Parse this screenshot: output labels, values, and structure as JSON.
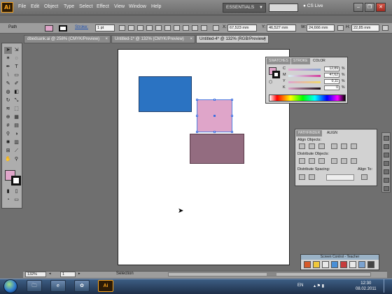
{
  "app": {
    "badge": "Ai"
  },
  "menu": [
    "File",
    "Edit",
    "Object",
    "Type",
    "Select",
    "Effect",
    "View",
    "Window",
    "Help"
  ],
  "workspace": {
    "label": "ESSENTIALS"
  },
  "cslive": {
    "label": "CS Live"
  },
  "window_controls": {
    "minimize": "–",
    "restore": "❐",
    "close": "✕"
  },
  "control_bar": {
    "selection_type": "Path",
    "stroke_label": "Stroke:",
    "stroke_weight": "1 pt",
    "x_label": "X:",
    "x_value": "67,523 mm",
    "y_label": "Y:",
    "y_value": "46,527 mm",
    "w_label": "W:",
    "w_value": "24,666 mm",
    "h_label": "H:",
    "h_value": "22,85 mm"
  },
  "doc_tabs": [
    {
      "label": "dbedsank.ai @ 258% (CMYK/Preview)"
    },
    {
      "label": "Untitled-1* @ 132% (CMYK/Preview)"
    },
    {
      "label": "Untitled-4* @ 132% (RGB/Preview)"
    }
  ],
  "color_panel": {
    "tabs": [
      "SWATCHES",
      "STROKE",
      "COLOR"
    ],
    "channels": [
      {
        "label": "C",
        "value": "12,89"
      },
      {
        "label": "M",
        "value": "47,62"
      },
      {
        "label": "Y",
        "value": "0,11"
      },
      {
        "label": "K",
        "value": "0"
      }
    ],
    "percent": "%"
  },
  "align_panel": {
    "tabs": [
      "PATHFINDER",
      "ALIGN"
    ],
    "align_objects": "Align Objects:",
    "distribute_objects": "Distribute Objects:",
    "distribute_spacing": "Distribute Spacing:",
    "align_to": "Align To:"
  },
  "screen_control": {
    "title": "Screen Control - Teacher"
  },
  "status_bar": {
    "zoom": "132%",
    "page": "1",
    "mode": "Selection"
  },
  "taskbar": {
    "app_label": "Ai",
    "language": "EN",
    "time": "12:30",
    "date": "08.02.2011"
  },
  "colors": {
    "fill": "#dfa5c9",
    "blue_rect": "#2b73c2",
    "pink_rect": "#dfa5c9",
    "mauve_rect": "#936c80",
    "ai_accent": "#f7a21b"
  }
}
